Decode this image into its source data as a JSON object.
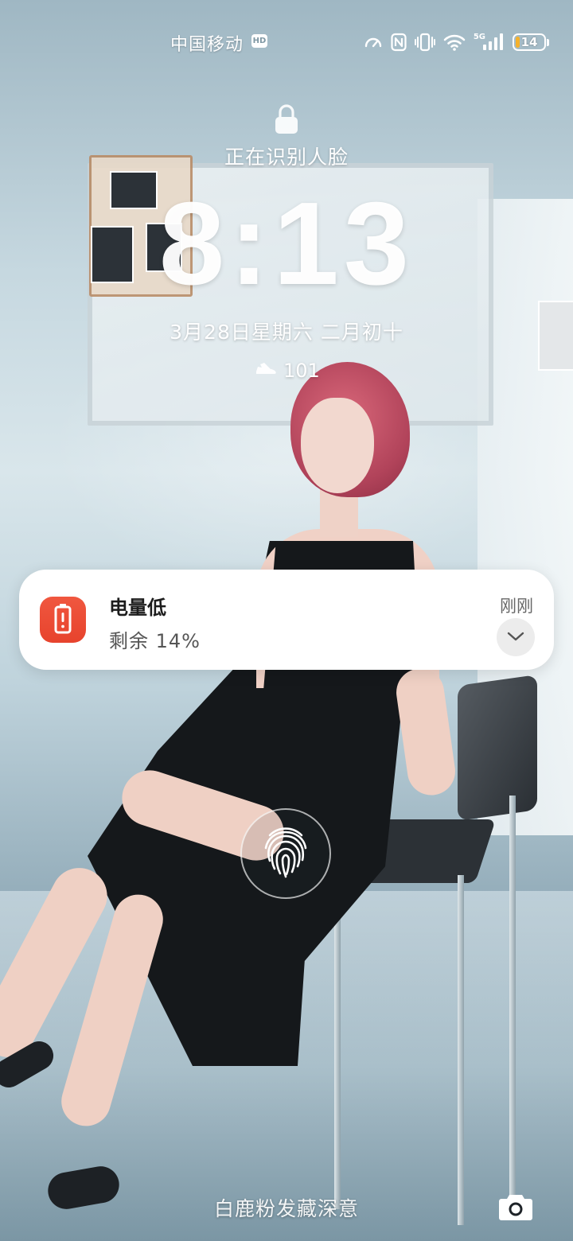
{
  "status_bar": {
    "carrier": "中国移动",
    "hd_badge": "HD",
    "network_label": "5G",
    "battery_percent": "14",
    "battery_level": 0.14,
    "icons": [
      "speed-icon",
      "nfc-icon",
      "vibrate-icon",
      "wifi-icon",
      "signal-icon",
      "battery-icon"
    ]
  },
  "lock": {
    "icon": "lock-icon",
    "face_status": "正在识别人脸"
  },
  "clock": {
    "time": "8:13",
    "date": "3月28日星期六  二月初十"
  },
  "steps": {
    "icon": "shoe-icon",
    "count": "101"
  },
  "notification": {
    "app_icon": "battery-alert-icon",
    "title": "电量低",
    "body": "剩余 14%",
    "time": "刚刚",
    "accent": "#EC4B33"
  },
  "fingerprint": {
    "icon": "fingerprint-icon"
  },
  "bottom": {
    "caption": "白鹿粉发藏深意",
    "camera_icon": "camera-icon"
  }
}
